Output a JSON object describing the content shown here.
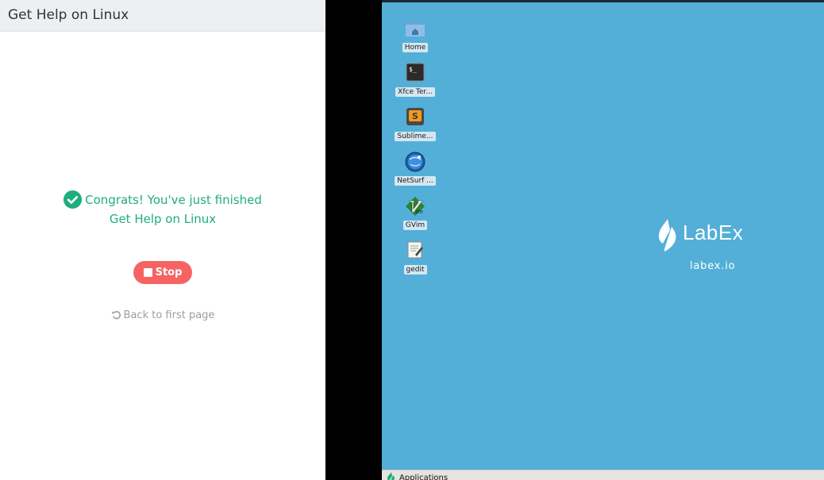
{
  "lab": {
    "title": "Get Help on Linux",
    "congrats_line1": "Congrats! You've just finished",
    "congrats_line2": "Get Help on Linux",
    "stop_label": "Stop",
    "back_label": "Back to first page"
  },
  "desktop": {
    "icons": [
      {
        "label": "Home",
        "icon": "home-folder-icon"
      },
      {
        "label": "Xfce Ter...",
        "icon": "terminal-icon"
      },
      {
        "label": "Sublime...",
        "icon": "sublime-text-icon"
      },
      {
        "label": "NetSurf ...",
        "icon": "netsurf-browser-icon"
      },
      {
        "label": "GVim",
        "icon": "gvim-icon"
      },
      {
        "label": "gedit",
        "icon": "gedit-icon"
      }
    ],
    "brand_name": "LabEx",
    "brand_url": "labex.io",
    "taskbar": {
      "applications_label": "Applications"
    }
  },
  "colors": {
    "accent_green": "#1fad7e",
    "stop_red": "#f66363",
    "desktop_blue": "#53afd8"
  }
}
